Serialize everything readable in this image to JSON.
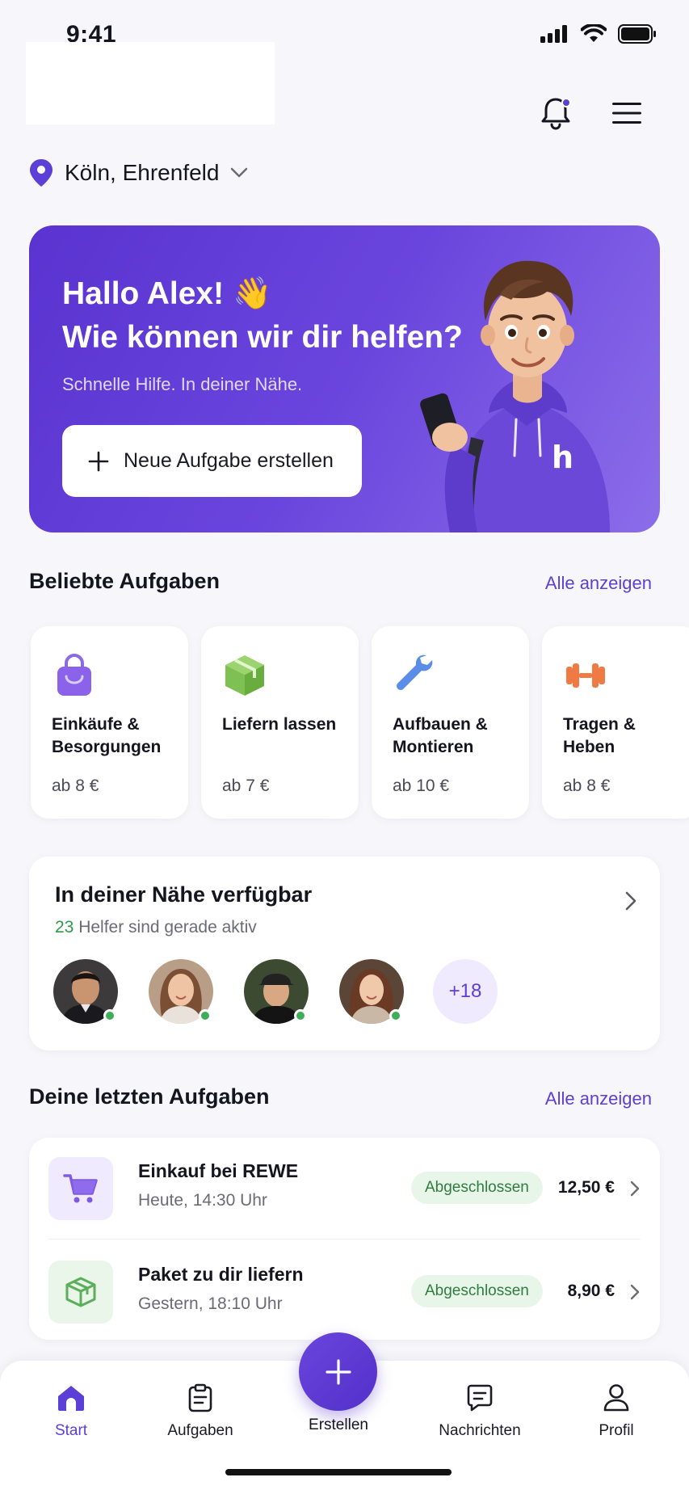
{
  "status_bar": {
    "time": "9:41"
  },
  "header": {
    "location": "Köln, Ehrenfeld",
    "icons": [
      "bell-icon",
      "menu-icon",
      "location-pin-icon",
      "chevron-down-icon"
    ]
  },
  "hero": {
    "greeting_line1": "Hallo Alex! 👋",
    "greeting_line2": "Wie können wir dir helfen?",
    "subtitle": "Schnelle Hilfe. In deiner Nähe.",
    "cta_label": "Neue Aufgabe erstellen"
  },
  "popular": {
    "title": "Beliebte Aufgaben",
    "see_all": "Alle anzeigen",
    "items": [
      {
        "name": "Einkäufe & Besorgungen",
        "price": "ab 8 €",
        "icon": "shopping-bag-icon"
      },
      {
        "name": "Liefern lassen",
        "price": "ab 7 €",
        "icon": "package-icon"
      },
      {
        "name": "Aufbauen & Montieren",
        "price": "ab 10 €",
        "icon": "wrench-icon"
      },
      {
        "name": "Tragen & Heben",
        "price": "ab 8 €",
        "icon": "dumbbell-icon"
      }
    ]
  },
  "nearby": {
    "title": "In deiner Nähe verfügbar",
    "count": "23",
    "subtitle_rest": " Helfer sind gerade aktiv",
    "more": "+18"
  },
  "recent": {
    "title": "Deine letzten Aufgaben",
    "see_all": "Alle anzeigen",
    "items": [
      {
        "title": "Einkauf bei REWE",
        "time": "Heute, 14:30 Uhr",
        "status": "Abgeschlossen",
        "price": "12,50 €",
        "icon": "cart-icon"
      },
      {
        "title": "Paket zu dir liefern",
        "time": "Gestern, 18:10 Uhr",
        "status": "Abgeschlossen",
        "price": "8,90 €",
        "icon": "box-icon"
      }
    ]
  },
  "nav": {
    "items": [
      {
        "label": "Start",
        "icon": "home-icon",
        "active": true
      },
      {
        "label": "Aufgaben",
        "icon": "clipboard-icon"
      },
      {
        "label": "Erstellen",
        "icon": "plus-icon"
      },
      {
        "label": "Nachrichten",
        "icon": "chat-icon"
      },
      {
        "label": "Profil",
        "icon": "user-icon"
      }
    ]
  },
  "colors": {
    "accent": "#5b3fd6",
    "success": "#2f9a4a",
    "background": "#f7f7fb"
  }
}
